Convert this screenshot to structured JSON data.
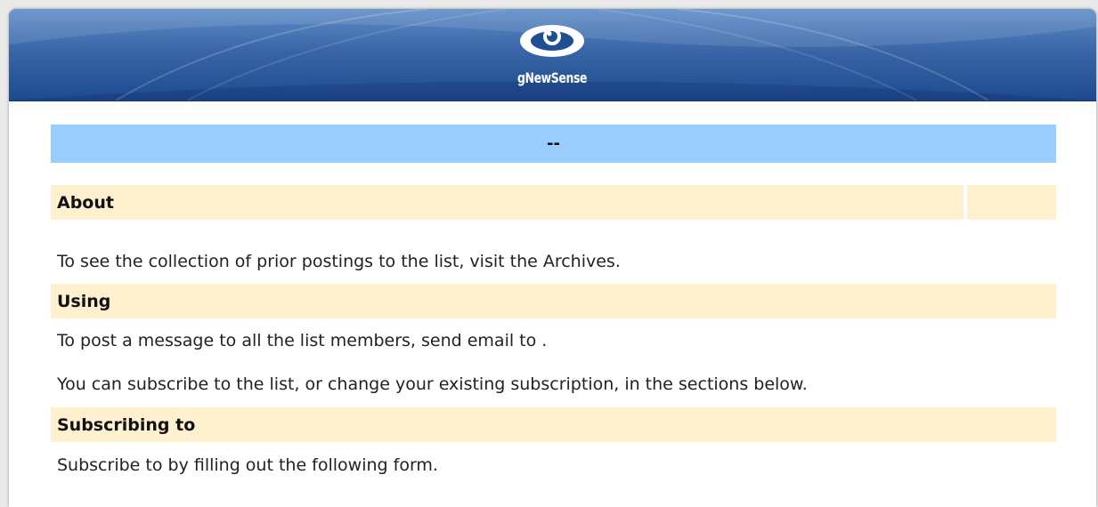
{
  "brand": {
    "logo_text": "gNewSense"
  },
  "list_title": "--",
  "sections": {
    "about": {
      "heading": "About",
      "side_heading": "",
      "archives_text": "To see the collection of prior postings to the list, visit the Archives."
    },
    "using": {
      "heading": "Using",
      "post_text": "To post a message to all the list members, send email to .",
      "subscribe_text": "You can subscribe to the list, or change your existing subscription, in the sections below."
    },
    "subscribing": {
      "heading": "Subscribing to",
      "form_text": "Subscribe to by filling out the following form."
    }
  },
  "colors": {
    "title_bar": "#99ccff",
    "section_head": "#fff0d0",
    "banner_top": "#5f8dc7",
    "banner_bottom": "#1d4a8f"
  }
}
